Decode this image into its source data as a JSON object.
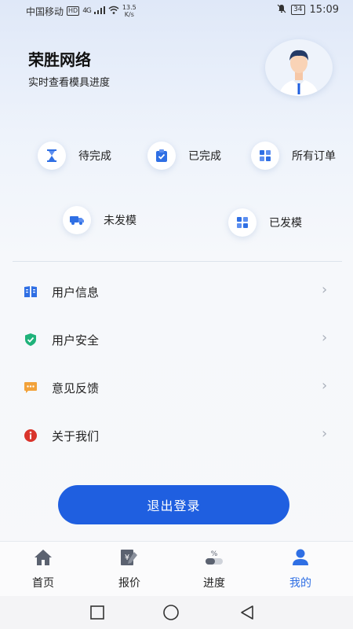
{
  "status_bar": {
    "carrier": "中国移动",
    "hd": "HD",
    "signal": "4G",
    "net_speed_value": "13.5",
    "net_speed_unit": "K/s",
    "battery": "34",
    "time": "15:09"
  },
  "header": {
    "brand": "荣胜网络",
    "subtitle": "实时查看模具进度"
  },
  "shortcuts": [
    {
      "label": "待完成",
      "icon": "hourglass-icon"
    },
    {
      "label": "已完成",
      "icon": "clipboard-check-icon"
    },
    {
      "label": "所有订单",
      "icon": "grid-icon"
    },
    {
      "label": "未发模",
      "icon": "truck-icon"
    },
    {
      "label": "已发模",
      "icon": "grid-icon"
    }
  ],
  "menu": [
    {
      "label": "用户信息",
      "icon": "book-icon",
      "color": "#2f6fe4"
    },
    {
      "label": "用户安全",
      "icon": "shield-check-icon",
      "color": "#1fb27a"
    },
    {
      "label": "意见反馈",
      "icon": "chat-bubble-icon",
      "color": "#f2a23a"
    },
    {
      "label": "关于我们",
      "icon": "info-icon",
      "color": "#d9342b"
    }
  ],
  "logout_label": "退出登录",
  "tabs": [
    {
      "label": "首页",
      "icon": "home-icon"
    },
    {
      "label": "报价",
      "icon": "quote-icon"
    },
    {
      "label": "进度",
      "icon": "progress-icon"
    },
    {
      "label": "我的",
      "icon": "user-icon",
      "active": true
    }
  ],
  "colors": {
    "primary": "#1f5fe0",
    "active_tab": "#2f6fe4"
  }
}
